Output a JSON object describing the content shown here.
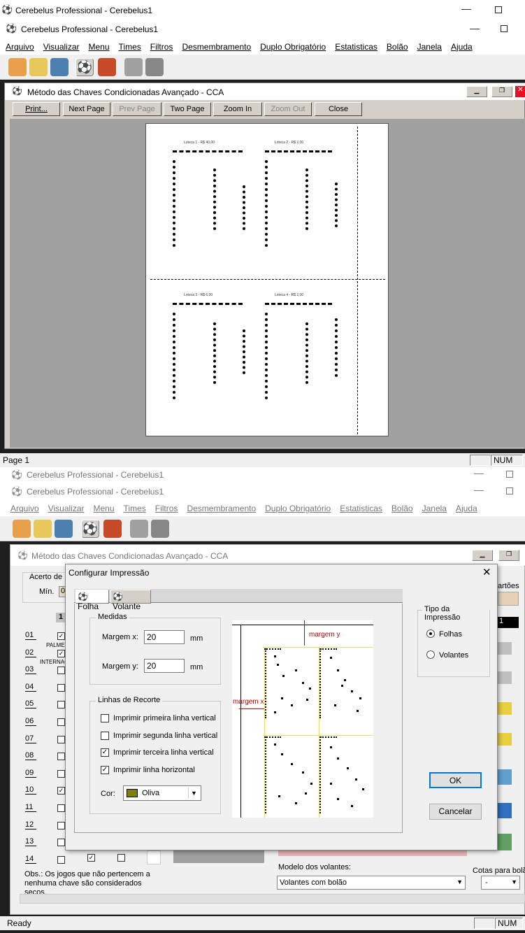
{
  "top_window": {
    "outer_title": "Cerebelus Professional - Cerebelus1",
    "inner_title": "Cerebelus Professional - Cerebelus1",
    "menu": [
      "Arquivo",
      "Visualizar",
      "Menu",
      "Times",
      "Filtros",
      "Desmembramento",
      "Duplo Obrigatório",
      "Estatisticas",
      "Bolão",
      "Janela",
      "Ajuda"
    ],
    "child_title": "Método das Chaves Condicionadas Avançado - CCA",
    "preview_buttons": {
      "print": "Print...",
      "next": "Next Page",
      "prev": "Prev Page",
      "two": "Two Page",
      "zoom_in": "Zoom In",
      "zoom_out": "Zoom Out",
      "close": "Close"
    },
    "sheet_labels": [
      "Loteca 1 - R$ 40,00",
      "Loteca 2 - R$ 2,00",
      "Loteca 3 - R$ 6,00",
      "Loteca 4 - R$ 2,00"
    ],
    "status_page": "Page 1",
    "status_num": "NUM"
  },
  "bottom_window": {
    "outer_title": "Cerebelus Professional - Cerebelus1",
    "inner_title": "Cerebelus Professional - Cerebelus1",
    "menu": [
      "Arquivo",
      "Visualizar",
      "Menu",
      "Times",
      "Filtros",
      "Desmembramento",
      "Duplo Obrigatório",
      "Estatisticas",
      "Bolão",
      "Janela",
      "Ajuda"
    ],
    "child_title": "Método das Chaves Condicionadas Avançado - CCA",
    "acerto_label": "Acerto de",
    "min_label": "Mín.",
    "min_value": "0",
    "col_header": "1",
    "rows": [
      "01",
      "02",
      "03",
      "04",
      "05",
      "06",
      "07",
      "08",
      "09",
      "10",
      "11",
      "12",
      "13",
      "14"
    ],
    "team_a": "PALMEI",
    "team_b": "INTERNAC",
    "cartoes_label": "artões",
    "right_value": "1",
    "obs": "Obs.: Os jogos que não pertencem a nenhuma chave são considerados secos.",
    "modelo_label": "Modelo dos volantes:",
    "modelo_value": "Volantes com bolão",
    "cotas_label": "Cotas para bolão",
    "cotas_value": "-",
    "status_ready": "Ready",
    "status_num": "NUM"
  },
  "dialog": {
    "title": "Configurar Impressão",
    "tabs": [
      "Folha",
      "Volante"
    ],
    "medidas_title": "Medidas",
    "margem_x_label": "Margem x:",
    "margem_x_value": "20",
    "margem_y_label": "Margem y:",
    "margem_y_value": "20",
    "unit": "mm",
    "linhas_title": "Linhas de Recorte",
    "checks": [
      {
        "label": "Imprimir primeira linha vertical",
        "checked": false
      },
      {
        "label": "Imprimir segunda linha vertical",
        "checked": false
      },
      {
        "label": "Imprimir terceira linha vertical",
        "checked": true
      },
      {
        "label": "Imprimir linha horizontal",
        "checked": true
      }
    ],
    "cor_label": "Cor:",
    "cor_value": "Oliva",
    "cor_color": "#808000",
    "tipo_title": "Tipo da Impressão",
    "radio_folhas": "Folhas",
    "radio_volantes": "Volantes",
    "tipo_selected": "Folhas",
    "diagram_margem_y": "margem y",
    "diagram_margem_x": "margem x",
    "ok": "OK",
    "cancel": "Cancelar"
  }
}
